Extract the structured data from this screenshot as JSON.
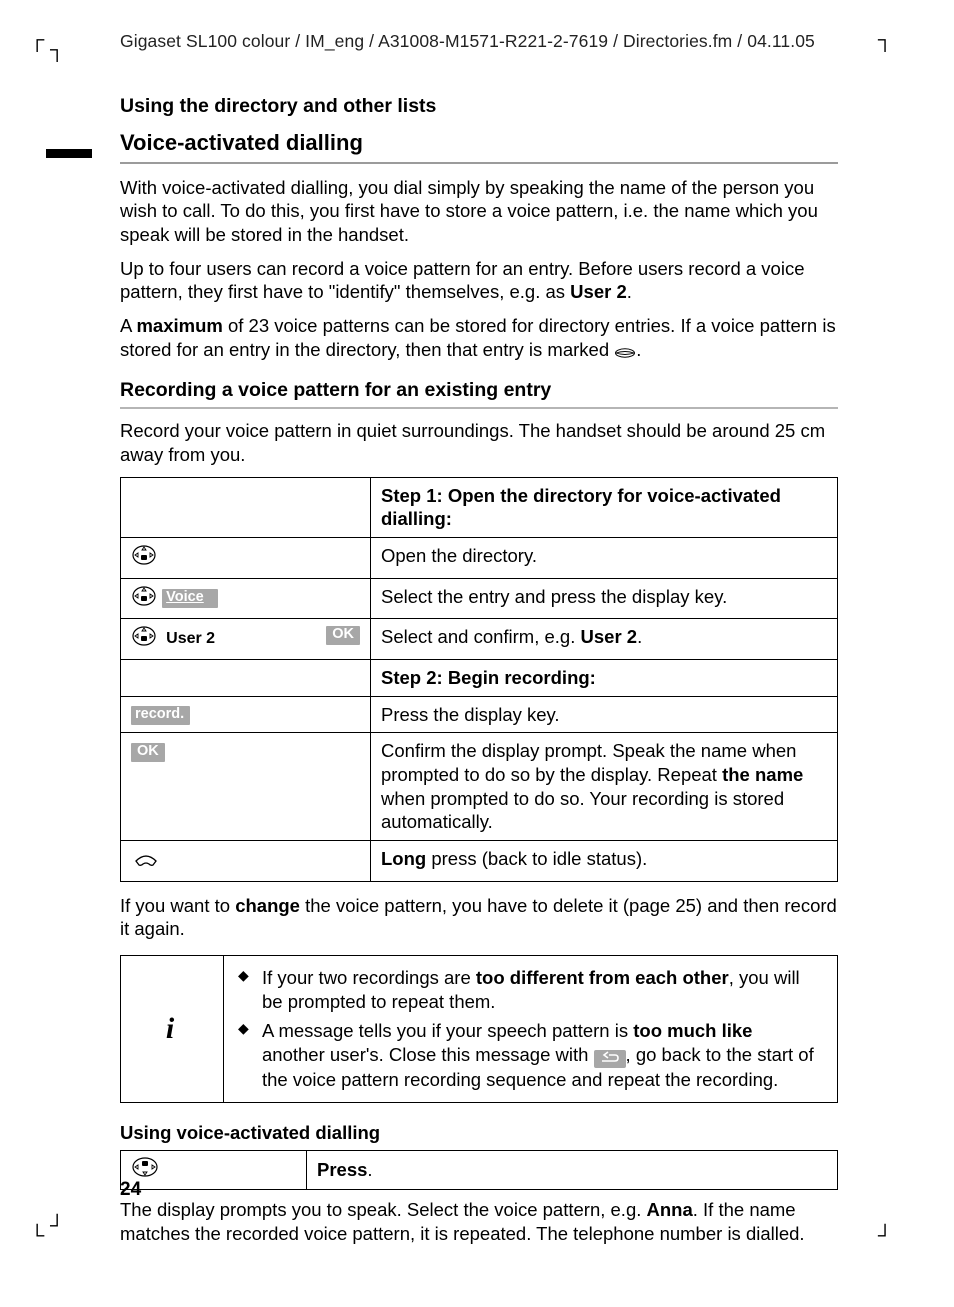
{
  "runhead": "Gigaset SL100 colour / IM_eng / A31008-M1571-R221-2-7619 / Directories.fm / 04.11.05",
  "section": "Using the directory and other lists",
  "title": "Voice-activated dialling",
  "intro1": "With voice-activated dialling, you dial simply by speaking the name of the person you wish to call. To do this, you first have to store a voice pattern, i.e. the name which you speak will be stored in the handset.",
  "intro2a": "Up to four users can record a voice pattern for an entry. Before users record a voice pattern, they first have to \"identify\" themselves, e.g. as ",
  "intro2b": "User 2",
  "intro2c": ".",
  "intro3a": "A ",
  "intro3b": "maximum",
  "intro3c": " of 23 voice patterns can be stored for directory entries. If a voice pattern is stored for an entry in the directory, then that entry is marked ",
  "intro3d": ".",
  "sub1": "Recording a voice pattern for an existing entry",
  "sub1text": "Record your voice pattern in quiet surroundings. The handset should be around 25 cm away from you.",
  "table": {
    "step1": "Step 1: Open the directory for voice-activated dialling:",
    "r1": "Open the directory.",
    "r2key": "Voice",
    "r2": "Select the entry and press the display key.",
    "r3key": "User 2",
    "r3ok": "OK",
    "r3a": "Select and confirm, e.g. ",
    "r3b": "User 2",
    "r3c": ".",
    "step2": "Step 2: Begin recording:",
    "r4key": "record.",
    "r4": "Press the display key.",
    "r5key": "OK",
    "r5a": "Confirm the display prompt. Speak the name when prompted to do so by the display. Repeat ",
    "r5b": "the name",
    "r5c": " when prompted to do so. Your recording is stored automatically.",
    "r6a": "Long",
    "r6b": " press (back to idle status)."
  },
  "after1a": "If you want to ",
  "after1b": "change",
  "after1c": " the voice pattern, you have to delete it (page 25) and then record it again.",
  "info": {
    "b1a": "If your two recordings are ",
    "b1b": "too different from each other",
    "b1c": ", you will be prompted to repeat them.",
    "b2a": "A message tells you if your speech pattern is ",
    "b2b": "too much like",
    "b2c": " another user's. Close this message with ",
    "b2d": ", go back to the start of the voice pattern recording sequence and repeat the recording."
  },
  "sub2": "Using voice-activated dialling",
  "small": {
    "right": "Press",
    "rightpunct": "."
  },
  "closing1": "The display prompts you to speak. Select the voice pattern, e.g. ",
  "closing1b": "Anna",
  "closing1c": ". If the name matches the recorded voice pattern, it is repeated. The telephone number is dialled.",
  "pagenum": "24"
}
